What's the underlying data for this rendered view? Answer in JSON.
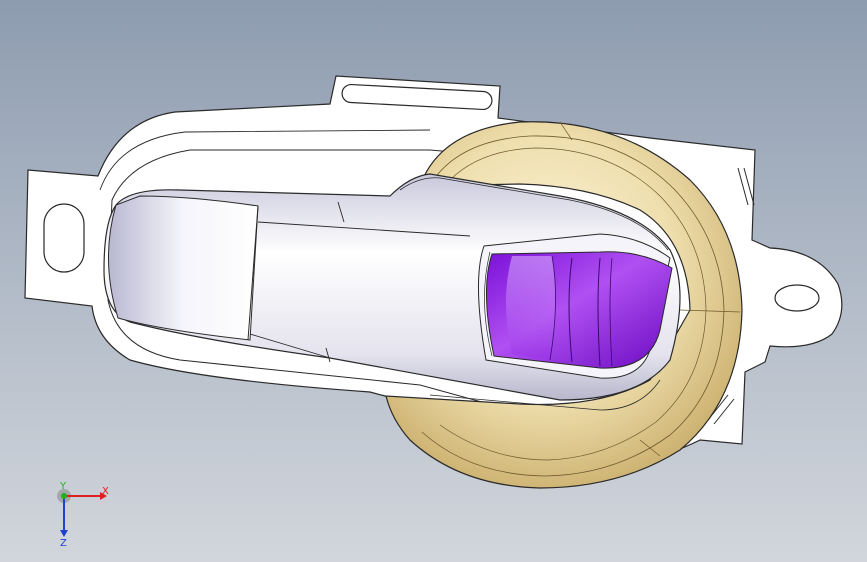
{
  "colors": {
    "background_top": "#8e9cb0",
    "background_bottom": "#d2d6dc",
    "bracket": "#ffffff",
    "handle": "#e8e8f2",
    "bezel": "#ead9a3",
    "button": "#9a2be0",
    "edge": "#2a2a2a",
    "axis_x": "#e02020",
    "axis_y": "#20b020",
    "axis_z": "#2040d0"
  },
  "triad": {
    "x_label": "X",
    "y_label": "Y",
    "z_label": "Z"
  }
}
